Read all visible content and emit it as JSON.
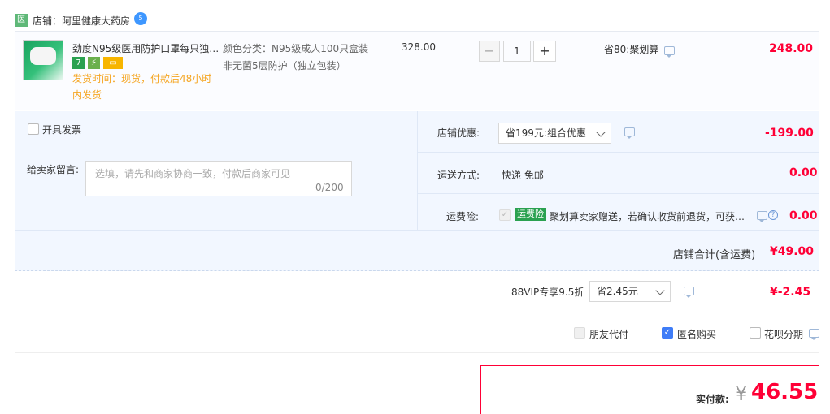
{
  "shop": {
    "icon_text": "医",
    "name": "店铺：阿里健康大药房",
    "badge": "5"
  },
  "item": {
    "title": "劲度N95级医用防护口罩每只独…",
    "delivery_line1": "发货时间：现货，付款后48小时",
    "delivery_line2": "内发货",
    "sku_line1": "颜色分类：N95级成人100只盒装",
    "sku_line2": "非无菌5层防护（独立包装）",
    "unit_price": "328.00",
    "qty_minus": "−",
    "quantity": "1",
    "qty_plus": "+",
    "promo": "省80:聚划算",
    "subtotal": "248.00",
    "tags": [
      "7",
      "⚡",
      "▭"
    ]
  },
  "invoice": {
    "label": "开具发票"
  },
  "message": {
    "label": "给卖家留言:",
    "placeholder": "选填，请先和商家协商一致，付款后商家可见",
    "counter": "0/200"
  },
  "shop_discount": {
    "label": "店铺优惠:",
    "selected": "省199元:组合优惠",
    "amount": "-199.00"
  },
  "shipping": {
    "label": "运送方式:",
    "value": "快递 免邮",
    "amount": "0.00"
  },
  "insurance": {
    "label": "运费险:",
    "tag": "运费险",
    "text": "聚划算卖家赠送，若确认收货前退货，可获…",
    "help": "?",
    "amount": "0.00"
  },
  "shop_total": {
    "label": "店铺合计(含运费)",
    "amount": "¥49.00"
  },
  "vip": {
    "label": "88VIP专享9.5折",
    "selected": "省2.45元",
    "amount": "¥-2.45"
  },
  "options": {
    "friend_pay": "朋友代付",
    "anonymous": "匿名购买",
    "huabei": "花呗分期",
    "check": "✓"
  },
  "payment": {
    "label": "实付款:",
    "currency": "¥",
    "amount": "46.55"
  },
  "colors": {
    "accent_red": "#ff0036",
    "panel_bg": "#f2f7ff",
    "insurance_green": "#2aa150",
    "checkbox_blue": "#3e7cf7"
  }
}
